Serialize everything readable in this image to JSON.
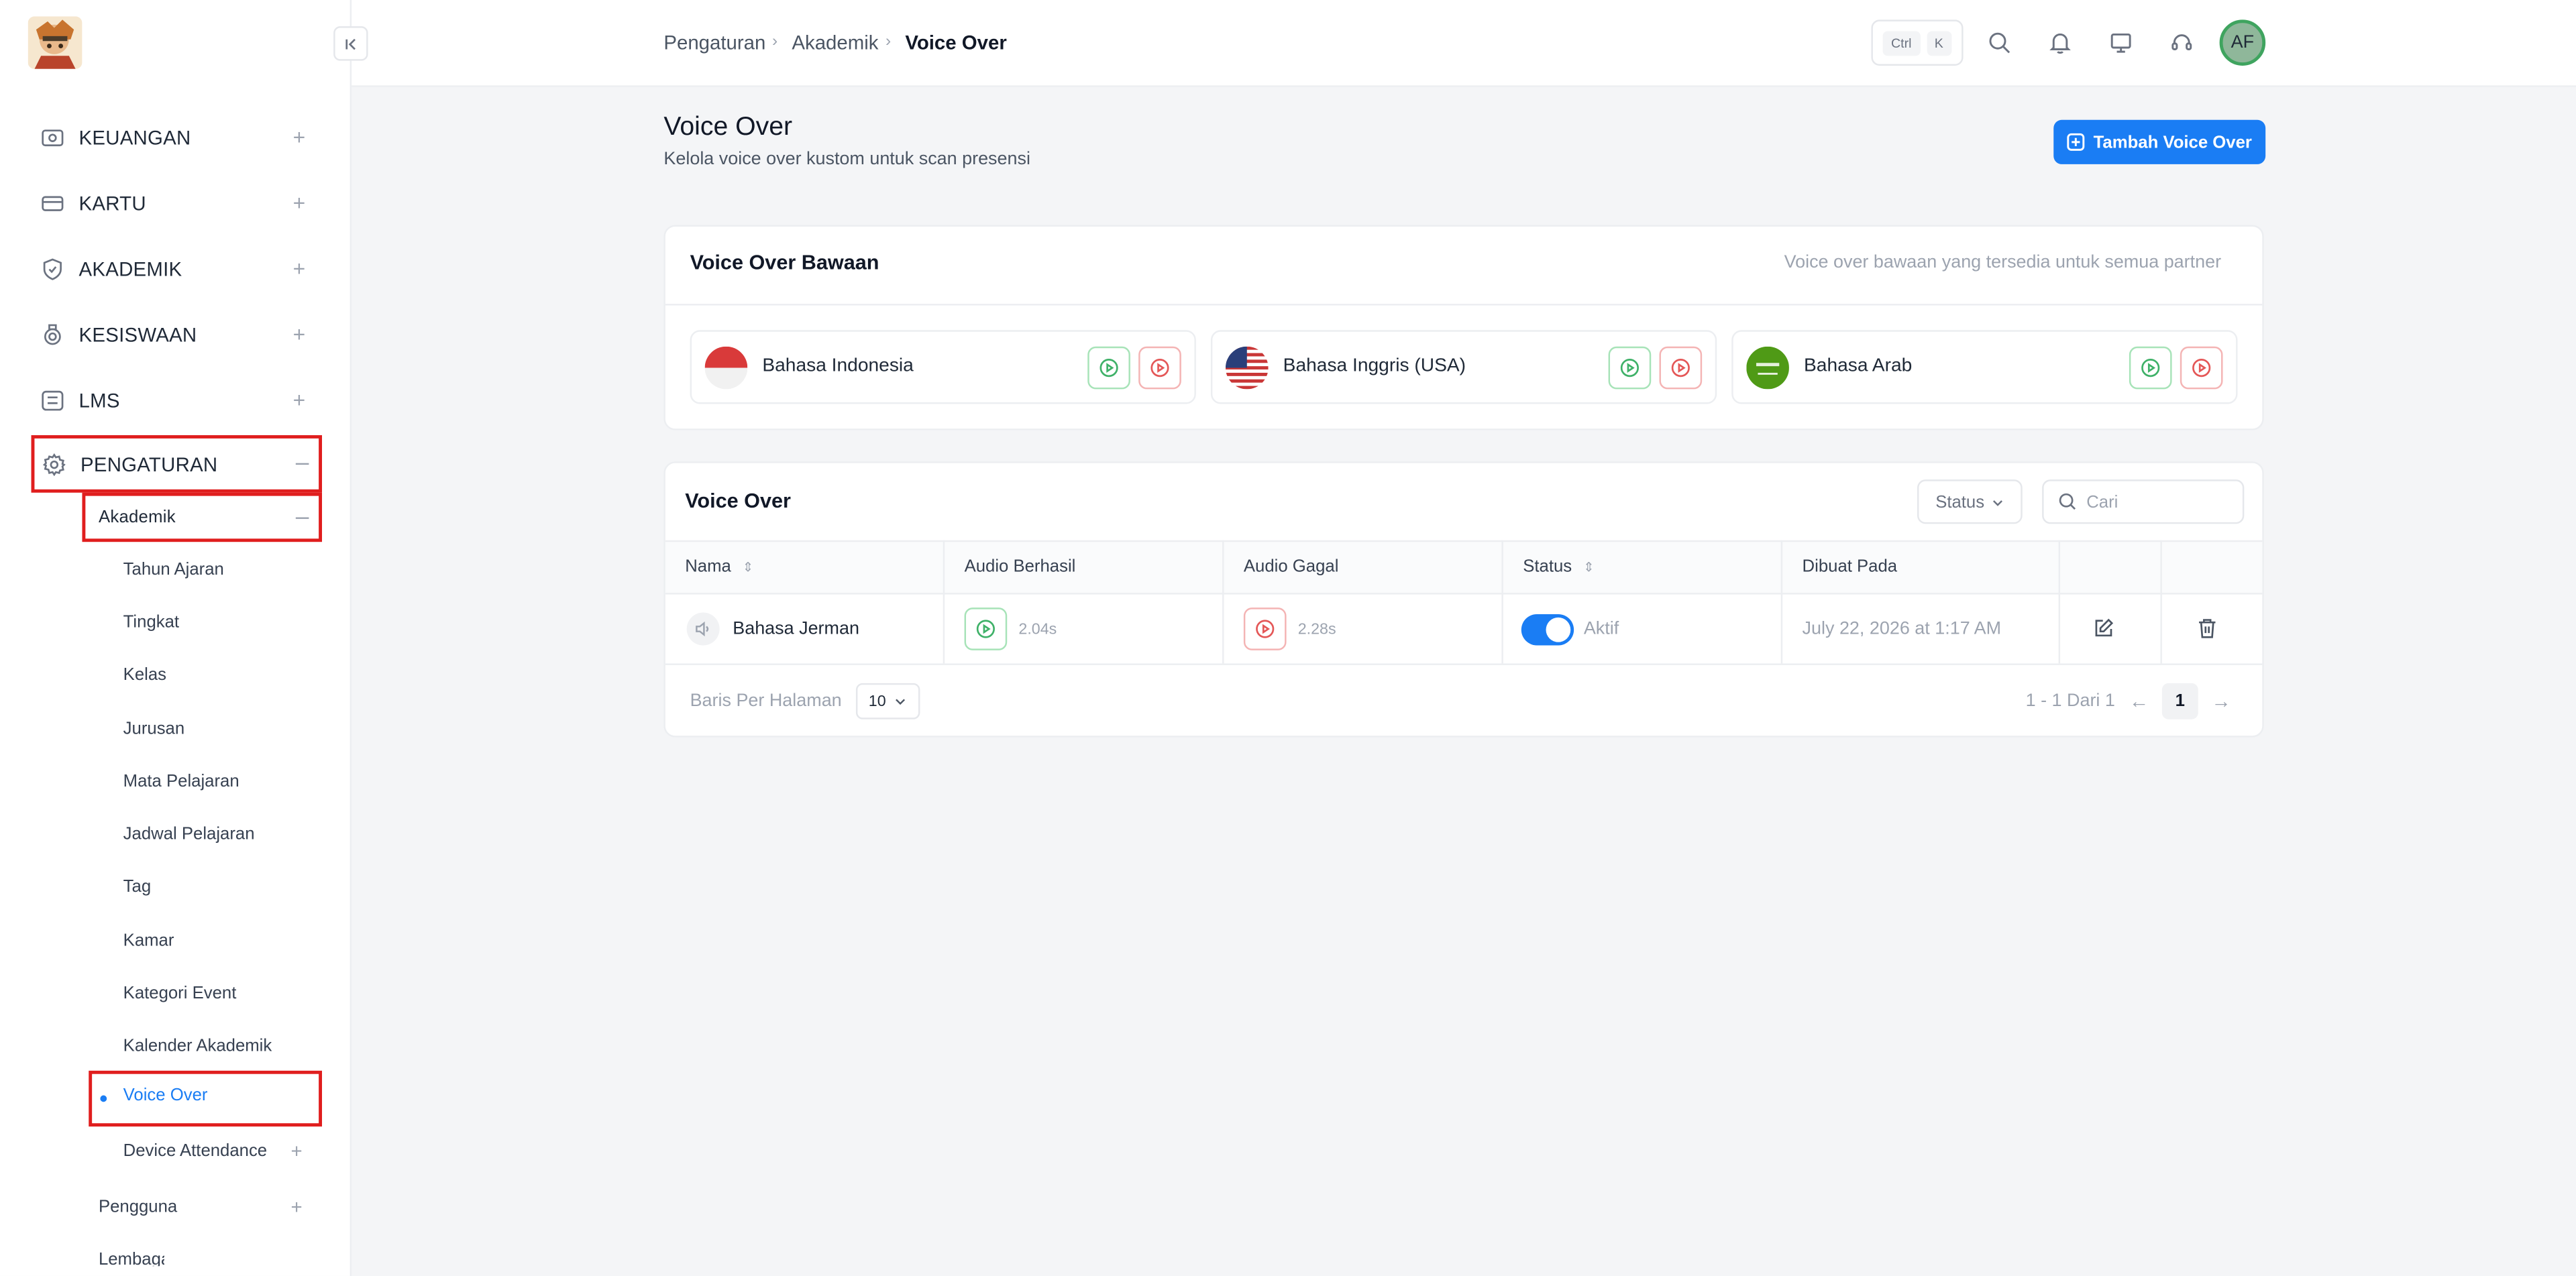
{
  "sidebar": {
    "items": [
      {
        "label": "KEUANGAN",
        "icon": "wallet-icon"
      },
      {
        "label": "KARTU",
        "icon": "card-icon"
      },
      {
        "label": "AKADEMIK",
        "icon": "shield-icon"
      },
      {
        "label": "KESISWAAN",
        "icon": "badge-icon"
      },
      {
        "label": "LMS",
        "icon": "list-icon"
      },
      {
        "label": "PENGATURAN",
        "icon": "gear-icon"
      }
    ],
    "sub_group": "Akademik",
    "sub_items": [
      "Tahun Ajaran",
      "Tingkat",
      "Kelas",
      "Jurusan",
      "Mata Pelajaran",
      "Jadwal Pelajaran",
      "Tag",
      "Kamar",
      "Kategori Event",
      "Kalender Akademik",
      "Voice Over",
      "Device Attendance"
    ],
    "next_group": "Pengguna",
    "cut_item": "Lembaga"
  },
  "breadcrumb": [
    "Pengaturan",
    "Akademik",
    "Voice Over"
  ],
  "shortcut": {
    "ctrl": "Ctrl",
    "key": "K"
  },
  "avatar": "AF",
  "page": {
    "title": "Voice Over",
    "subtitle": "Kelola voice over kustom untuk scan presensi",
    "add_button": "Tambah Voice Over"
  },
  "default_card": {
    "title": "Voice Over Bawaan",
    "note": "Voice over bawaan yang tersedia untuk semua partner",
    "languages": [
      "Bahasa Indonesia",
      "Bahasa Inggris (USA)",
      "Bahasa Arab"
    ]
  },
  "table_card": {
    "title": "Voice Over",
    "filter_label": "Status",
    "search_placeholder": "Cari",
    "columns": [
      "Nama",
      "Audio Berhasil",
      "Audio Gagal",
      "Status",
      "Dibuat Pada"
    ],
    "rows": [
      {
        "name": "Bahasa Jerman",
        "success_duration": "2.04s",
        "fail_duration": "2.28s",
        "status": "Aktif",
        "created": "July 22, 2026 at 1:17 AM"
      }
    ],
    "rows_per_page_label": "Baris Per Halaman",
    "rows_per_page": "10",
    "range": "1 - 1 Dari 1",
    "page": "1"
  },
  "colors": {
    "primary": "#1a7df4",
    "highlight_box": "#e01e1e",
    "success": "#3fb168",
    "danger": "#e45757"
  }
}
